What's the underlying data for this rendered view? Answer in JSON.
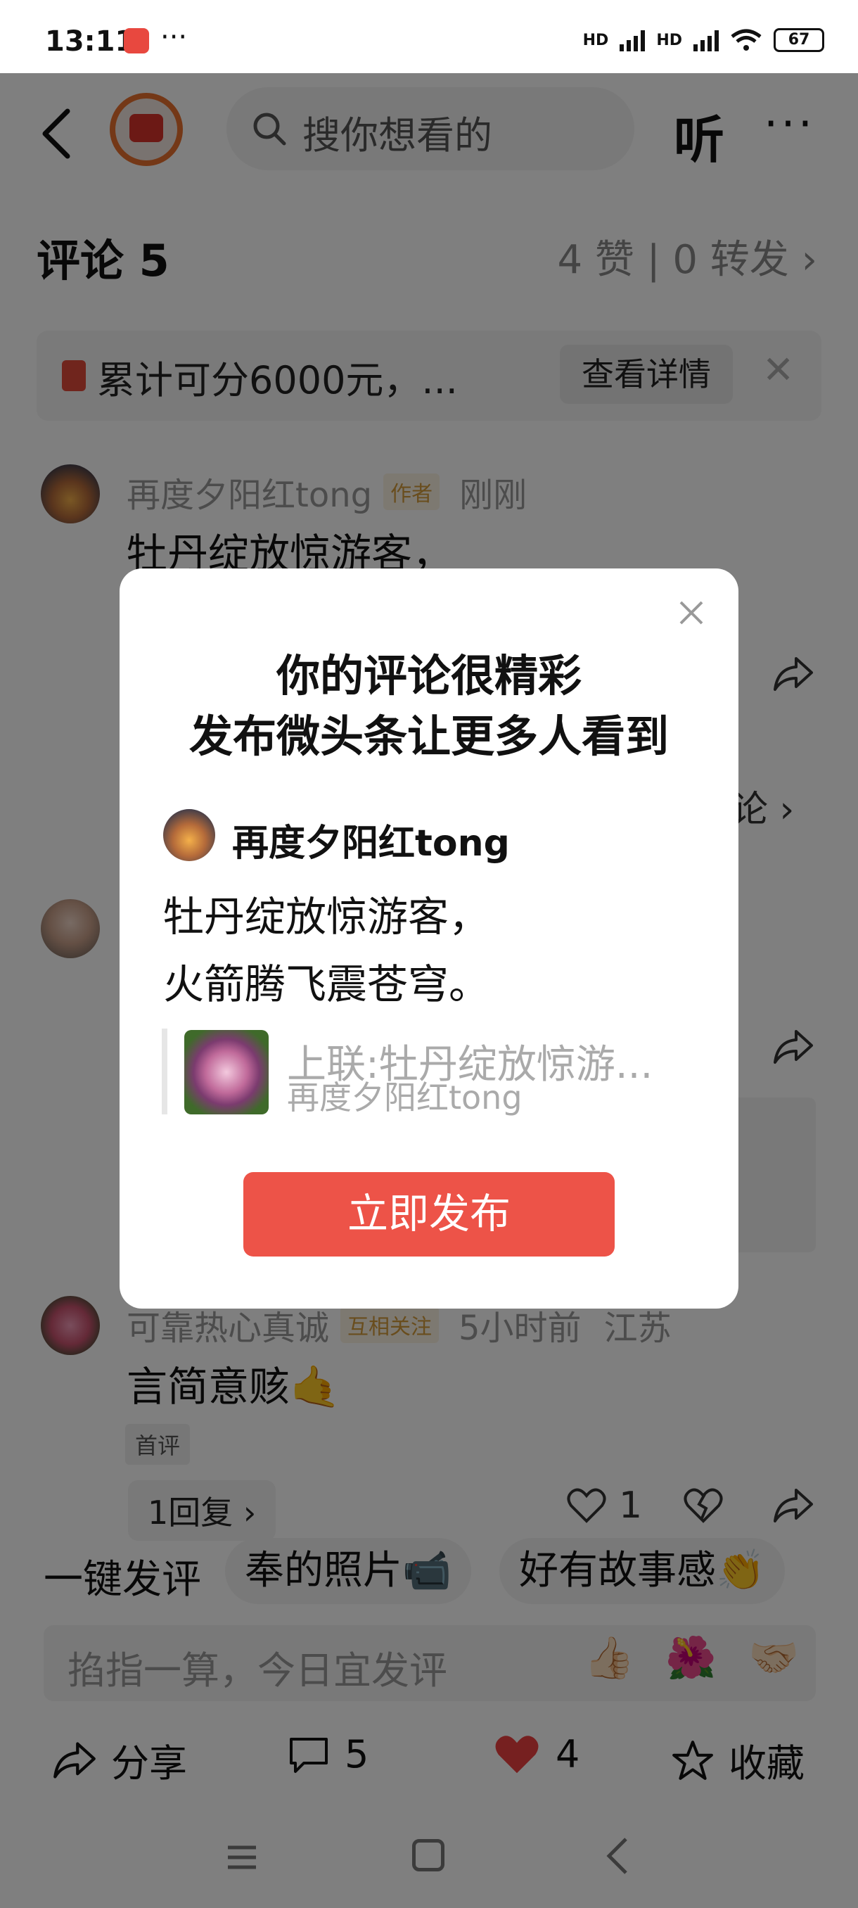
{
  "status_bar": {
    "time": "13:11",
    "more": "···",
    "signal1": "HD",
    "signal2": "HD",
    "battery": "67"
  },
  "top_bar": {
    "search_placeholder": "搜你想看的",
    "listen_label": "听",
    "more_label": "···"
  },
  "comments_header": {
    "title": "评论 5",
    "likes_forward": "4 赞 | 0 转发 ›"
  },
  "reward_banner": {
    "text": "累计可分6000元，...",
    "button": "查看详情",
    "close": "✕"
  },
  "comments": [
    {
      "name": "再度夕阳红tong",
      "tag": "作者",
      "time": "刚刚",
      "body": "牡丹绽放惊游客，"
    },
    {
      "name": "可靠热心真诚",
      "tag": "互相关注",
      "time": "5小时前",
      "location": "江苏",
      "body": "言简意赅🤙",
      "first_tag": "首评",
      "replies": "1回复 ›",
      "like_count": "1"
    }
  ],
  "peek_texts": {
    "view_more": "论 ›"
  },
  "quick_comment": {
    "label": "一键发评",
    "chips": [
      "奉的照片📹",
      "好有故事感👏"
    ]
  },
  "input_bar": {
    "placeholder": "掐指一算，今日宜发评",
    "emojis": [
      "👍🏻",
      "🌺",
      "🤝🏻"
    ]
  },
  "bottom_actions": {
    "share": "分享",
    "comment_count": "5",
    "like_count": "4",
    "favorite": "收藏"
  },
  "modal": {
    "title_line1": "你的评论很精彩",
    "title_line2": "发布微头条让更多人看到",
    "author": "再度夕阳红tong",
    "body_line1": "牡丹绽放惊游客，",
    "body_line2": "火箭腾飞震苍穹。",
    "quote_text": "上联:牡丹绽放惊游...",
    "quote_author": "再度夕阳红tong",
    "publish": "立即发布"
  },
  "colors": {
    "accent": "#ed5348",
    "overlay": "rgba(0,0,0,0.5)",
    "tag": "#d29a3a"
  }
}
